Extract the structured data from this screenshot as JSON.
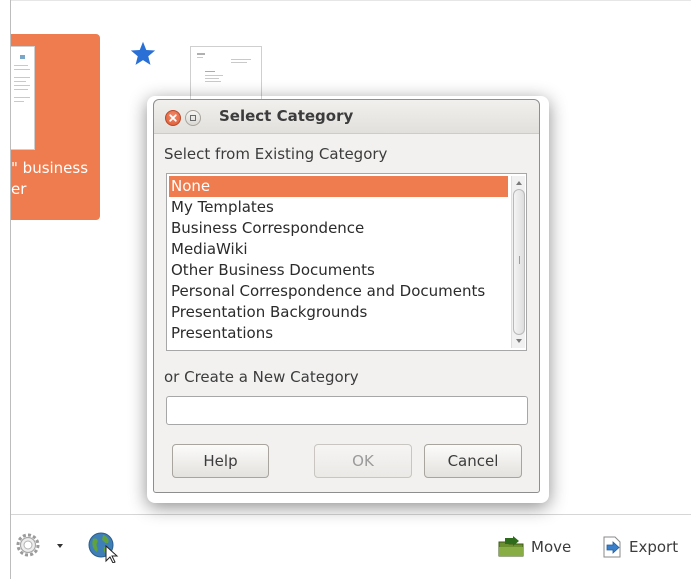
{
  "background": {
    "template_label_line1": "\" business",
    "template_label_line2": "er"
  },
  "dialog": {
    "title": "Select Category",
    "existing_label": "Select from Existing Category",
    "categories": [
      {
        "label": "None",
        "selected": true
      },
      {
        "label": "My Templates",
        "selected": false
      },
      {
        "label": "Business Correspondence",
        "selected": false
      },
      {
        "label": "MediaWiki",
        "selected": false
      },
      {
        "label": "Other Business Documents",
        "selected": false
      },
      {
        "label": "Personal Correspondence and Documents",
        "selected": false
      },
      {
        "label": "Presentation Backgrounds",
        "selected": false
      },
      {
        "label": "Presentations",
        "selected": false
      }
    ],
    "new_label": "or Create a New Category",
    "new_value": "",
    "buttons": {
      "help": "Help",
      "ok": "OK",
      "cancel": "Cancel"
    },
    "ok_enabled": false
  },
  "toolbar": {
    "move_label": "Move",
    "export_label": "Export",
    "icons": [
      "gear-icon",
      "chevron-down-icon",
      "globe-icon",
      "move-icon",
      "export-icon"
    ]
  },
  "colors": {
    "accent": "#ee7c4e",
    "star": "#2a6fd6",
    "dialog_bg": "#f2f1f0",
    "close_button": "#dc5a33"
  }
}
